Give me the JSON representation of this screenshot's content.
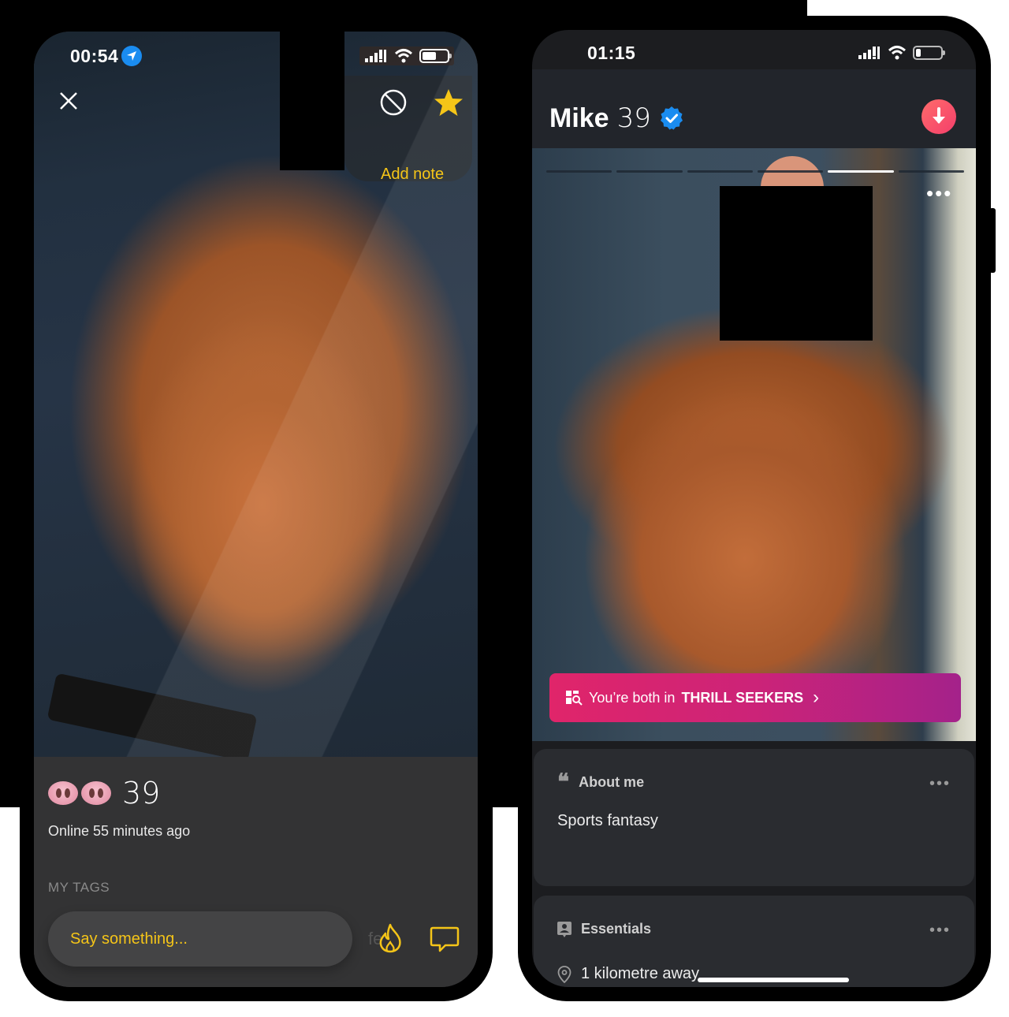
{
  "left_phone": {
    "status_bar": {
      "time": "00:54",
      "location_icon": "location-arrow-icon",
      "signal_icon": "cellular-signal-icon",
      "wifi_icon": "wifi-icon",
      "battery_level": 0.6
    },
    "toolbar": {
      "close_icon": "close-icon",
      "block_icon": "block-icon",
      "favorite_icon": "star-icon",
      "add_note_label": "Add note"
    },
    "profile": {
      "display_emoji": "pig-nose-pig-nose",
      "age": "39",
      "last_online": "Online 55 minutes ago",
      "tags_heading": "MY TAGS",
      "ghost_tag_text": "fe"
    },
    "composer": {
      "placeholder": "Say something...",
      "tap_icon": "flame-icon",
      "chat_icon": "chat-bubble-icon"
    },
    "colors": {
      "accent": "#f5c518",
      "panel": "#333334"
    }
  },
  "right_phone": {
    "status_bar": {
      "time": "01:15",
      "signal_icon": "cellular-signal-icon",
      "wifi_icon": "wifi-icon",
      "battery_level": 0.2
    },
    "header": {
      "name": "Mike",
      "age": "39",
      "verified_icon": "verified-badge-icon",
      "action_icon": "arrow-down-icon"
    },
    "photo_gallery": {
      "total_photos": 6,
      "current_photo": 5,
      "more_icon": "more-horizontal-icon"
    },
    "community_banner": {
      "icon": "group-search-icon",
      "prefix": "You’re both in",
      "group_name": "THRILL SEEKERS",
      "chevron": "›"
    },
    "about_me": {
      "icon": "quote-icon",
      "title": "About me",
      "text": "Sports fantasy"
    },
    "essentials": {
      "icon": "profile-card-icon",
      "title": "Essentials",
      "distance_icon": "location-pin-icon",
      "distance": "1 kilometre away"
    },
    "colors": {
      "banner_start": "#e0256a",
      "banner_end": "#a4228a",
      "action_button": "#f43f6b",
      "verified": "#1a8cf0"
    }
  }
}
